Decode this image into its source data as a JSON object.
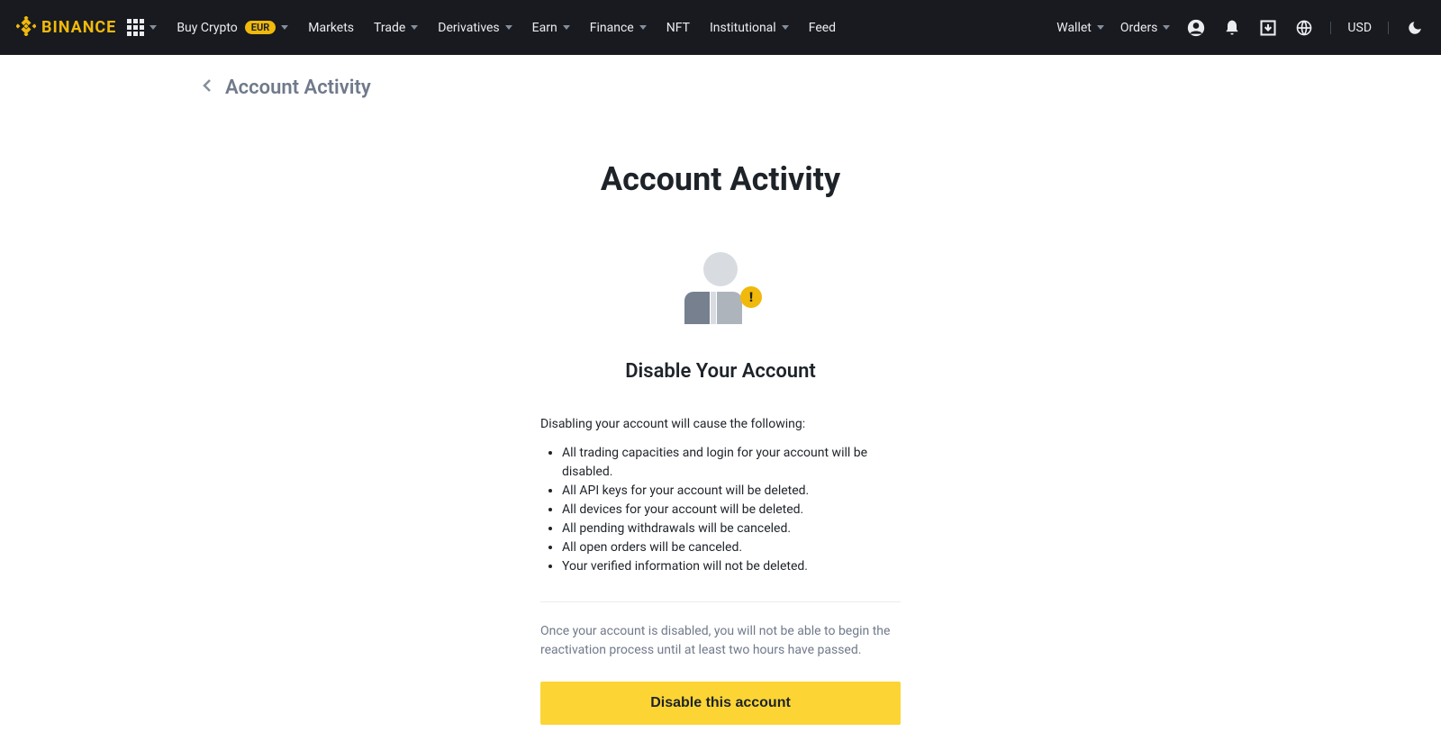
{
  "brand": "BINANCE",
  "nav": {
    "buyCrypto": "Buy Crypto",
    "buyCryptoBadge": "EUR",
    "markets": "Markets",
    "trade": "Trade",
    "derivatives": "Derivatives",
    "earn": "Earn",
    "finance": "Finance",
    "nft": "NFT",
    "institutional": "Institutional",
    "feed": "Feed",
    "wallet": "Wallet",
    "orders": "Orders",
    "currency": "USD"
  },
  "breadcrumb": {
    "title": "Account Activity"
  },
  "page": {
    "title": "Account Activity",
    "sectionTitle": "Disable Your Account",
    "intro": "Disabling your account will cause the following:",
    "bullets": [
      "All trading capacities and login for your account will be disabled.",
      "All API keys for your account will be deleted.",
      "All devices for your account will be deleted.",
      "All pending withdrawals will be canceled.",
      "All open orders will be canceled.",
      "Your verified information will not be deleted."
    ],
    "note": "Once your account is disabled, you will not be able to begin the reactivation process until at least two hours have passed.",
    "button": "Disable this account",
    "badgeChar": "!"
  }
}
